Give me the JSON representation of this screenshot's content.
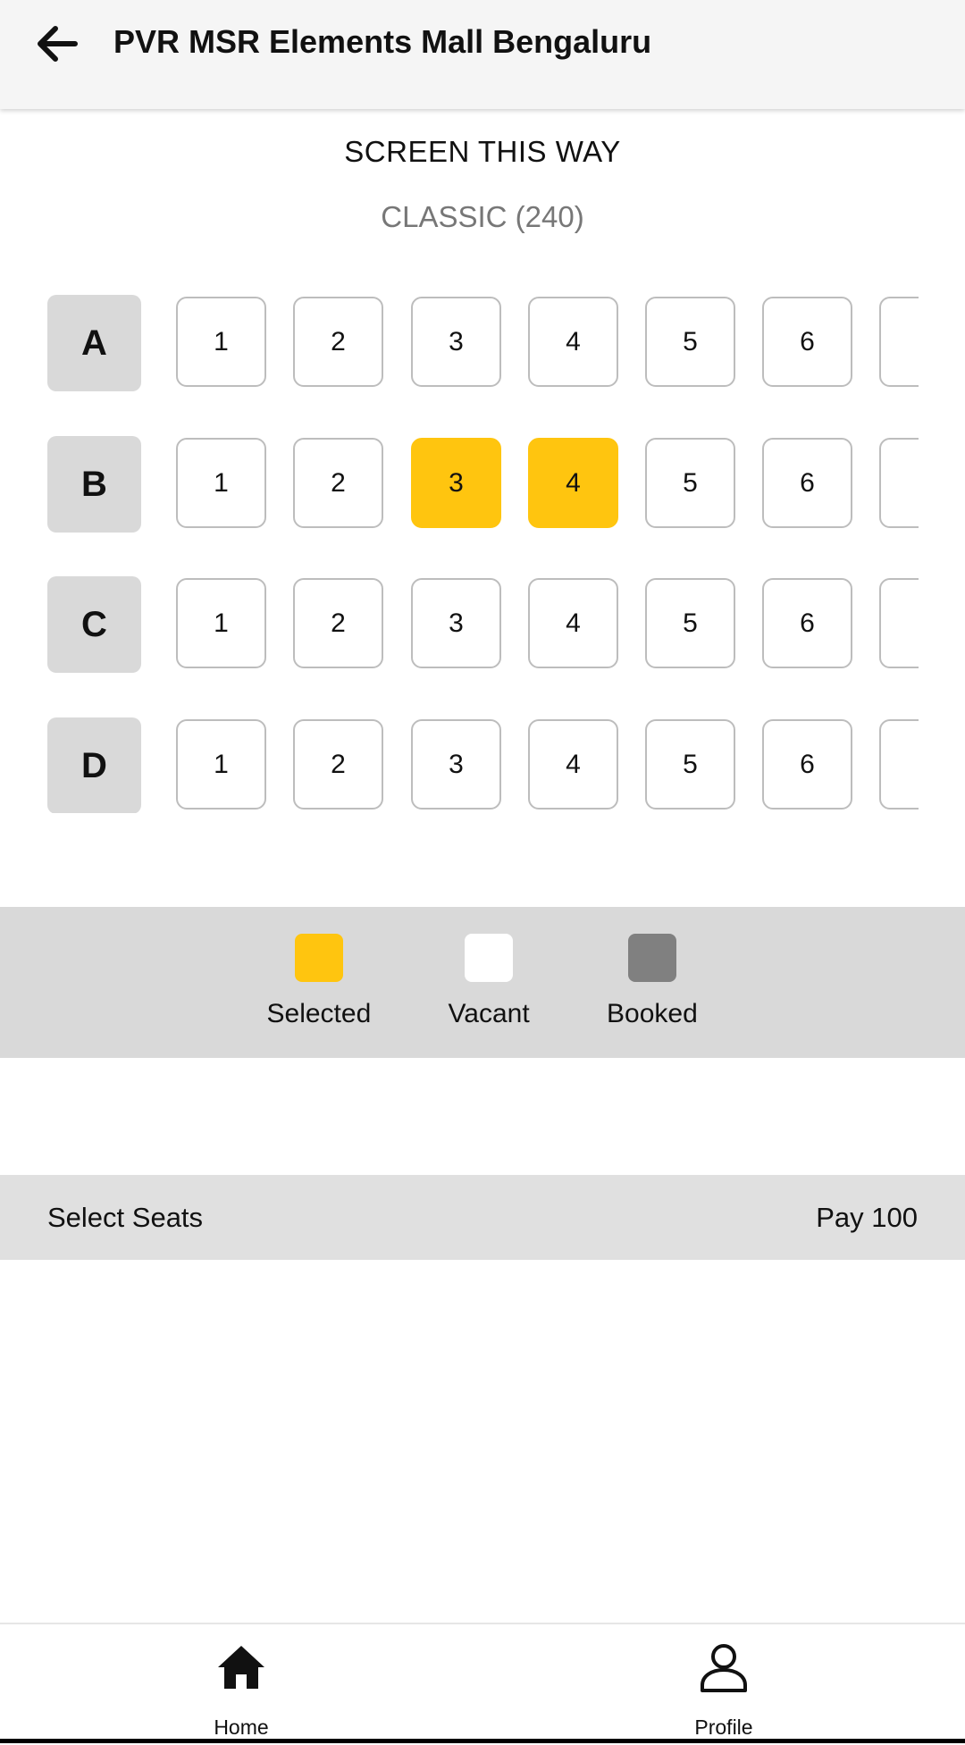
{
  "header": {
    "title": "PVR MSR Elements Mall Bengaluru",
    "back_icon": "arrow-left-icon"
  },
  "screen_label": "SCREEN THIS WAY",
  "class_label": "CLASSIC (240)",
  "rows": [
    {
      "label": "A",
      "seats": [
        "1",
        "2",
        "3",
        "4",
        "5",
        "6"
      ],
      "selected": []
    },
    {
      "label": "B",
      "seats": [
        "1",
        "2",
        "3",
        "4",
        "5",
        "6"
      ],
      "selected": [
        "3",
        "4"
      ]
    },
    {
      "label": "C",
      "seats": [
        "1",
        "2",
        "3",
        "4",
        "5",
        "6"
      ],
      "selected": []
    },
    {
      "label": "D",
      "seats": [
        "1",
        "2",
        "3",
        "4",
        "5",
        "6"
      ],
      "selected": []
    }
  ],
  "legend": [
    {
      "label": "Selected",
      "color": "#ffc50f"
    },
    {
      "label": "Vacant",
      "color": "#ffffff"
    },
    {
      "label": "Booked",
      "color": "#808080"
    }
  ],
  "footer": {
    "select_label": "Select Seats",
    "pay_label": "Pay 100"
  },
  "nav": [
    {
      "label": "Home",
      "icon": "home-icon"
    },
    {
      "label": "Profile",
      "icon": "profile-icon"
    }
  ],
  "colors": {
    "accent": "#ffc50f",
    "booked": "#808080",
    "row_label_bg": "#d9d9d9"
  }
}
